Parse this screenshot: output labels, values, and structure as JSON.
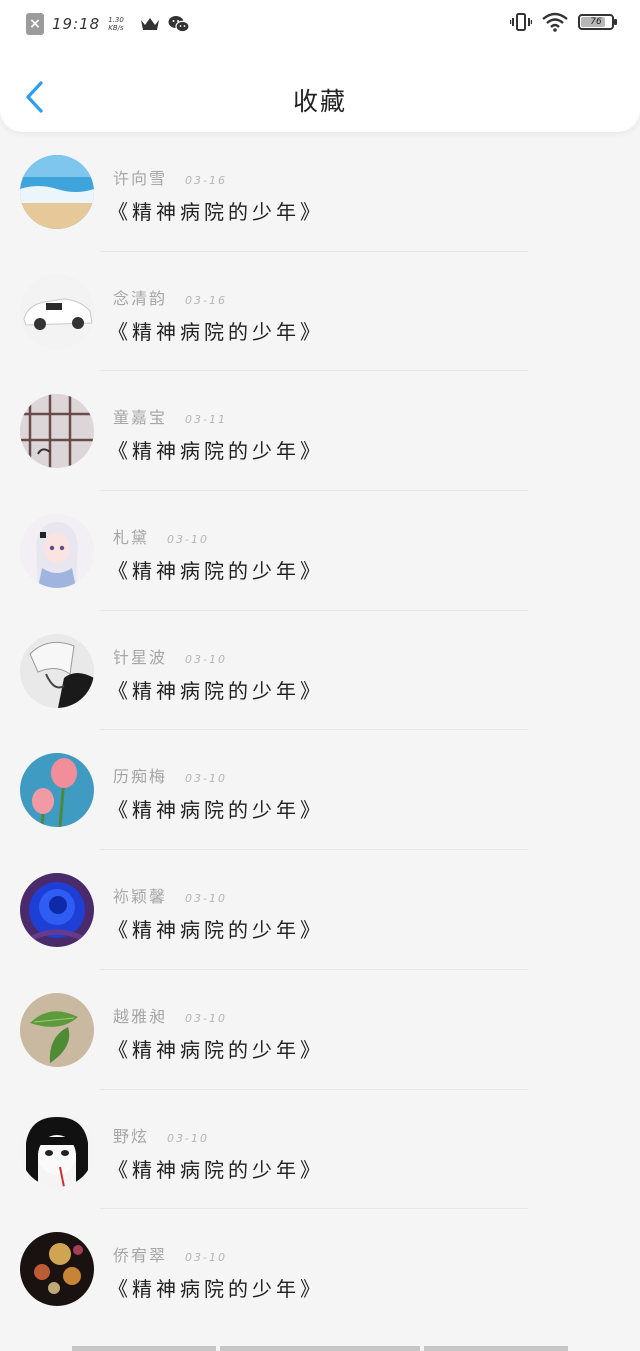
{
  "status_bar": {
    "time": "19:18",
    "speed_value": "1.30",
    "speed_unit": "KB/s",
    "battery": "76"
  },
  "header": {
    "title": "收藏"
  },
  "favorites": [
    {
      "name": "许向雪",
      "date": "03-16",
      "book": "《精神病院的少年》"
    },
    {
      "name": "念清韵",
      "date": "03-16",
      "book": "《精神病院的少年》"
    },
    {
      "name": "童嘉宝",
      "date": "03-11",
      "book": "《精神病院的少年》"
    },
    {
      "name": "札黛",
      "date": "03-10",
      "book": "《精神病院的少年》"
    },
    {
      "name": "针星波",
      "date": "03-10",
      "book": "《精神病院的少年》"
    },
    {
      "name": "历痴梅",
      "date": "03-10",
      "book": "《精神病院的少年》"
    },
    {
      "name": "袮颖馨",
      "date": "03-10",
      "book": "《精神病院的少年》"
    },
    {
      "name": "越雅昶",
      "date": "03-10",
      "book": "《精神病院的少年》"
    },
    {
      "name": "野炫",
      "date": "03-10",
      "book": "《精神病院的少年》"
    },
    {
      "name": "侨宥翠",
      "date": "03-10",
      "book": "《精神病院的少年》"
    }
  ],
  "icons": {
    "back": "chevron-left-icon",
    "notification": "close-box-icon",
    "crown": "crown-icon",
    "wechat": "wechat-icon",
    "vibrate": "vibrate-icon",
    "wifi": "wifi-icon",
    "battery": "battery-icon"
  },
  "colors": {
    "accent": "#2a9df4",
    "background": "#f5f5f5",
    "header": "#ffffff"
  }
}
